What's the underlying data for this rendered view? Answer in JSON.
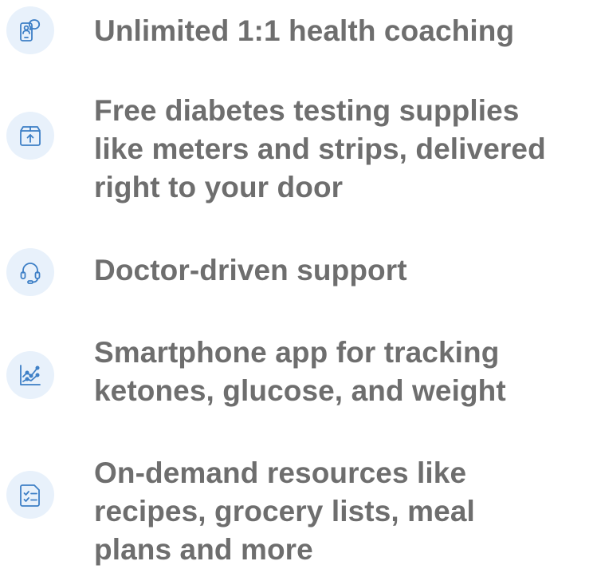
{
  "colors": {
    "text": "#6e6e6e",
    "icon_background": "#e8f1fb",
    "icon_stroke": "#3d7fc6"
  },
  "features": [
    {
      "icon": "phone-chat-icon",
      "lines": [
        "Unlimited 1:1 health coaching"
      ]
    },
    {
      "icon": "box-delivery-icon",
      "lines": [
        "Free diabetes testing supplies",
        "like meters and strips, delivered",
        "right to your door"
      ]
    },
    {
      "icon": "headset-icon",
      "lines": [
        "Doctor-driven support"
      ]
    },
    {
      "icon": "chart-tracking-icon",
      "lines": [
        "Smartphone app for tracking",
        "ketones, glucose, and weight"
      ]
    },
    {
      "icon": "checklist-document-icon",
      "lines": [
        "On-demand resources like",
        "recipes, grocery lists, meal",
        "plans and more"
      ]
    }
  ]
}
